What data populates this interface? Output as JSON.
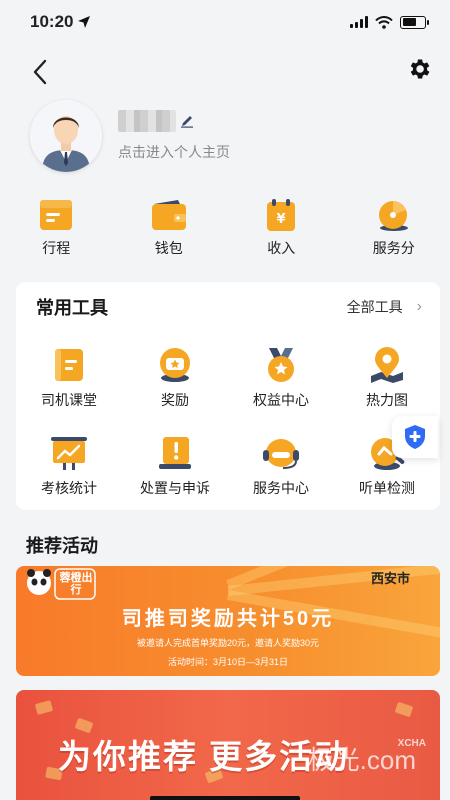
{
  "status": {
    "time": "10:20"
  },
  "profile": {
    "subtitle": "点击进入个人主页"
  },
  "quick_actions": [
    {
      "label": "行程",
      "icon": "itinerary-icon"
    },
    {
      "label": "钱包",
      "icon": "wallet-icon"
    },
    {
      "label": "收入",
      "icon": "income-icon"
    },
    {
      "label": "服务分",
      "icon": "service-score-icon"
    }
  ],
  "tools": {
    "title": "常用工具",
    "all_label": "全部工具",
    "items": [
      {
        "label": "司机课堂",
        "icon": "book-icon"
      },
      {
        "label": "奖励",
        "icon": "reward-icon"
      },
      {
        "label": "权益中心",
        "icon": "medal-icon"
      },
      {
        "label": "热力图",
        "icon": "map-pin-icon"
      },
      {
        "label": "考核统计",
        "icon": "chart-board-icon"
      },
      {
        "label": "处置与申诉",
        "icon": "appeal-icon"
      },
      {
        "label": "服务中心",
        "icon": "headset-icon"
      },
      {
        "label": "听单检测",
        "icon": "order-check-icon"
      }
    ]
  },
  "recommend": {
    "title": "推荐活动",
    "banner1": {
      "brand": "蓉橙出行",
      "city": "西安市",
      "headline": "司推司奖励共计50元",
      "subline": "被邀请人完成首单奖励20元，邀请人奖励30元",
      "date": "活动时间：3月10日—3月31日"
    },
    "banner2": {
      "headline": "为你推荐 更多活动",
      "watermark": "极光.com",
      "watermark_small": "XCHA"
    }
  },
  "colors": {
    "accent": "#f39a1e",
    "icon_dark": "#3b4a68",
    "background": "#f3f4f6"
  }
}
